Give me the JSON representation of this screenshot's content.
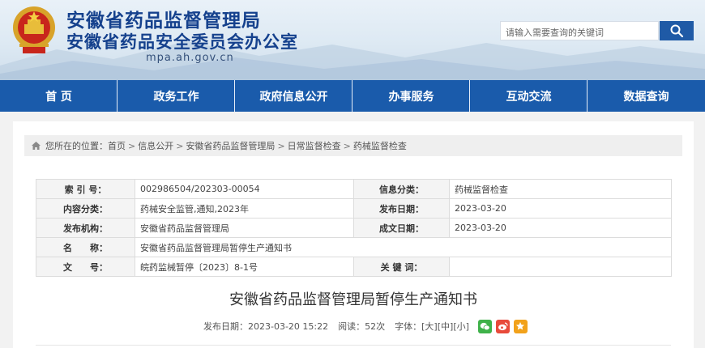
{
  "header": {
    "title": "安徽省药品监督管理局",
    "subtitle": "安徽省药品安全委员会办公室",
    "domain": "mpa.ah.gov.cn",
    "search_placeholder": "请输入需要查询的关键词",
    "emblem_icon": "national-emblem-icon",
    "search_icon": "search-icon"
  },
  "colors": {
    "brand": "#1a5bab",
    "title": "#15418d"
  },
  "nav": {
    "items": [
      "首 页",
      "政务工作",
      "政府信息公开",
      "办事服务",
      "互动交流",
      "数据查询"
    ]
  },
  "breadcrumb": {
    "prefix": "您所在的位置：",
    "items": [
      "首页",
      "信息公开",
      "安徽省药品监督管理局",
      "日常监督检查",
      "药械监督检查"
    ],
    "separator": ">",
    "icon": "home-icon"
  },
  "meta": {
    "index_label": "索 引 号：",
    "index_value": "002986504/202303-00054",
    "category_label": "信息分类：",
    "category_value": "药械监督检查",
    "content_label": "内容分类：",
    "content_value": "药械安全监管,通知,2023年",
    "pubdate_label": "发布日期：",
    "pubdate_value": "2023-03-20",
    "org_label": "发布机构：",
    "org_value": "安徽省药品监督管理局",
    "createdate_label": "成文日期：",
    "createdate_value": "2023-03-20",
    "name_label": "名　　称：",
    "name_value": "安徽省药品监督管理局暂停生产通知书",
    "docno_label": "文　　号：",
    "docno_value": "皖药监械暂停〔2023〕8-1号",
    "keywords_label": "关 键 词：",
    "keywords_value": ""
  },
  "article": {
    "title": "安徽省药品监督管理局暂停生产通知书",
    "published": "发布日期：2023-03-20 15:22",
    "views": "阅读：52次",
    "font_label": "字体：",
    "font_large": "[大]",
    "font_medium": "[中]",
    "font_small": "[小]",
    "share_icons": [
      "wechat-icon",
      "weibo-icon",
      "favorite-icon"
    ]
  }
}
